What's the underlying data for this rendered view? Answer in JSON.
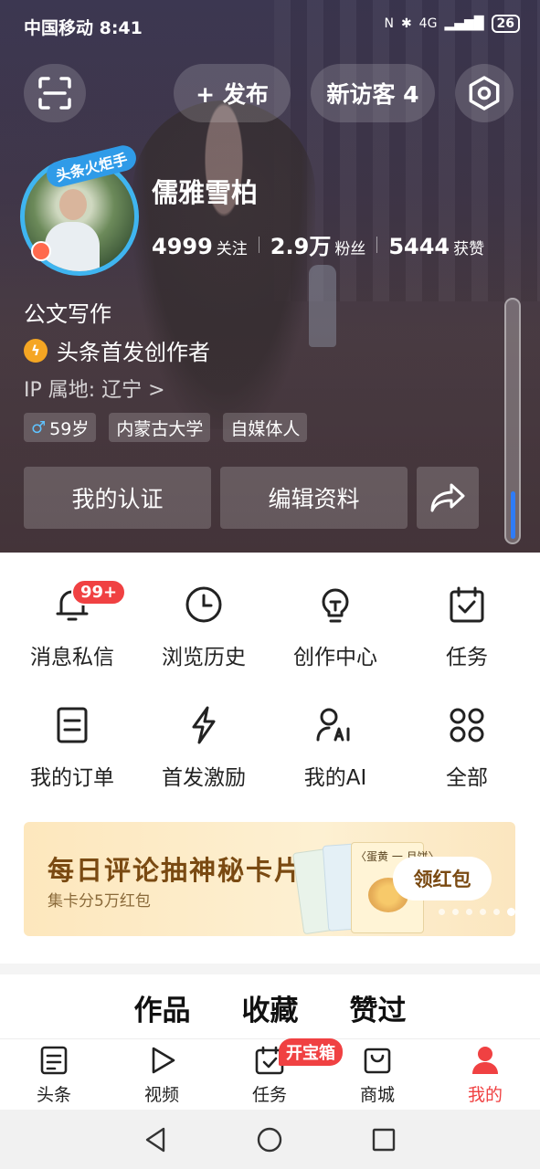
{
  "status": {
    "carrier_time": "中国移动 8:41",
    "signal": "4G",
    "battery": "26"
  },
  "header": {
    "publish_label": "+ 发布",
    "visitor_label": "新访客 4"
  },
  "profile": {
    "avatar_badge": "头条火炬手",
    "name": "儒雅雪柏",
    "stats": [
      {
        "num": "4999",
        "label": "关注"
      },
      {
        "num": "2.9万",
        "label": "粉丝"
      },
      {
        "num": "5444",
        "label": "获赞"
      }
    ],
    "bio": "公文写作",
    "creator_label": "头条首发创作者",
    "ip": "IP 属地: 辽宁 >",
    "tags": [
      "59岁",
      "内蒙古大学",
      "自媒体人"
    ],
    "actions": {
      "verify": "我的认证",
      "edit": "编辑资料"
    }
  },
  "grid": [
    {
      "label": "消息私信",
      "badge": "99+",
      "icon": "bell-icon"
    },
    {
      "label": "浏览历史",
      "icon": "clock-icon"
    },
    {
      "label": "创作中心",
      "icon": "bulb-icon"
    },
    {
      "label": "任务",
      "icon": "calendar-check-icon"
    },
    {
      "label": "我的订单",
      "icon": "order-icon"
    },
    {
      "label": "首发激励",
      "icon": "lightning-icon"
    },
    {
      "label": "我的AI",
      "icon": "ai-user-icon"
    },
    {
      "label": "全部",
      "icon": "grid-icon"
    }
  ],
  "banner": {
    "title": "每日评论抽神秘卡片",
    "subtitle": "集卡分5万红包",
    "card_text": "〈蛋黄 一 月饼〉",
    "button": "领红包"
  },
  "tabs": [
    "作品",
    "收藏",
    "赞过"
  ],
  "bottom_nav": [
    {
      "label": "头条",
      "icon": "news-icon"
    },
    {
      "label": "视频",
      "icon": "play-icon"
    },
    {
      "label": "任务",
      "icon": "task-icon",
      "badge": "开宝箱"
    },
    {
      "label": "商城",
      "icon": "shop-icon"
    },
    {
      "label": "我的",
      "icon": "user-icon",
      "active": true
    }
  ],
  "colors": {
    "accent": "#f04142",
    "avatar_ring": "#3fb5f0",
    "scroll_thumb": "#2f7cf6"
  }
}
